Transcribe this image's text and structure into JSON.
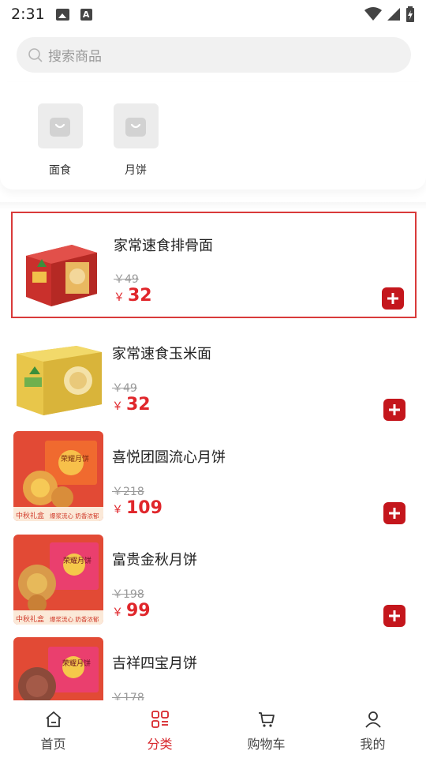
{
  "status_bar": {
    "time": "2:31",
    "icons": [
      "image-icon",
      "a-icon",
      "wifi-icon",
      "signal-icon",
      "battery-icon"
    ]
  },
  "search": {
    "placeholder": "搜索商品"
  },
  "categories": [
    {
      "label": "面食",
      "icon": "shopping-bag-icon"
    },
    {
      "label": "月饼",
      "icon": "shopping-bag-icon"
    }
  ],
  "products": [
    {
      "name": "家常速食排骨面",
      "original_price": "￥49",
      "currency": "￥",
      "price": "32",
      "selected": true
    },
    {
      "name": "家常速食玉米面",
      "original_price": "￥49",
      "currency": "￥",
      "price": "32",
      "selected": false
    },
    {
      "name": "喜悦团圆流心月饼",
      "original_price": "￥218",
      "currency": "￥",
      "price": "109",
      "selected": false
    },
    {
      "name": "富贵金秋月饼",
      "original_price": "￥198",
      "currency": "￥",
      "price": "99",
      "selected": false
    },
    {
      "name": "吉祥四宝月饼",
      "original_price": "￥178",
      "currency": "￥",
      "price": "",
      "selected": false
    }
  ],
  "product_images": {
    "mooncake_badge_left": "中秋礼盒",
    "mooncake_badge_right": "爆浆流心 奶香浓郁",
    "mooncake_box_text": "荣耀月饼"
  },
  "bottom_nav": [
    {
      "label": "首页",
      "icon": "home-icon",
      "active": false
    },
    {
      "label": "分类",
      "icon": "category-icon",
      "active": true
    },
    {
      "label": "购物车",
      "icon": "cart-icon",
      "active": false
    },
    {
      "label": "我的",
      "icon": "user-icon",
      "active": false
    }
  ],
  "colors": {
    "accent_red": "#d7262b",
    "add_button": "#c4161c",
    "selected_border": "#d93a3a"
  }
}
